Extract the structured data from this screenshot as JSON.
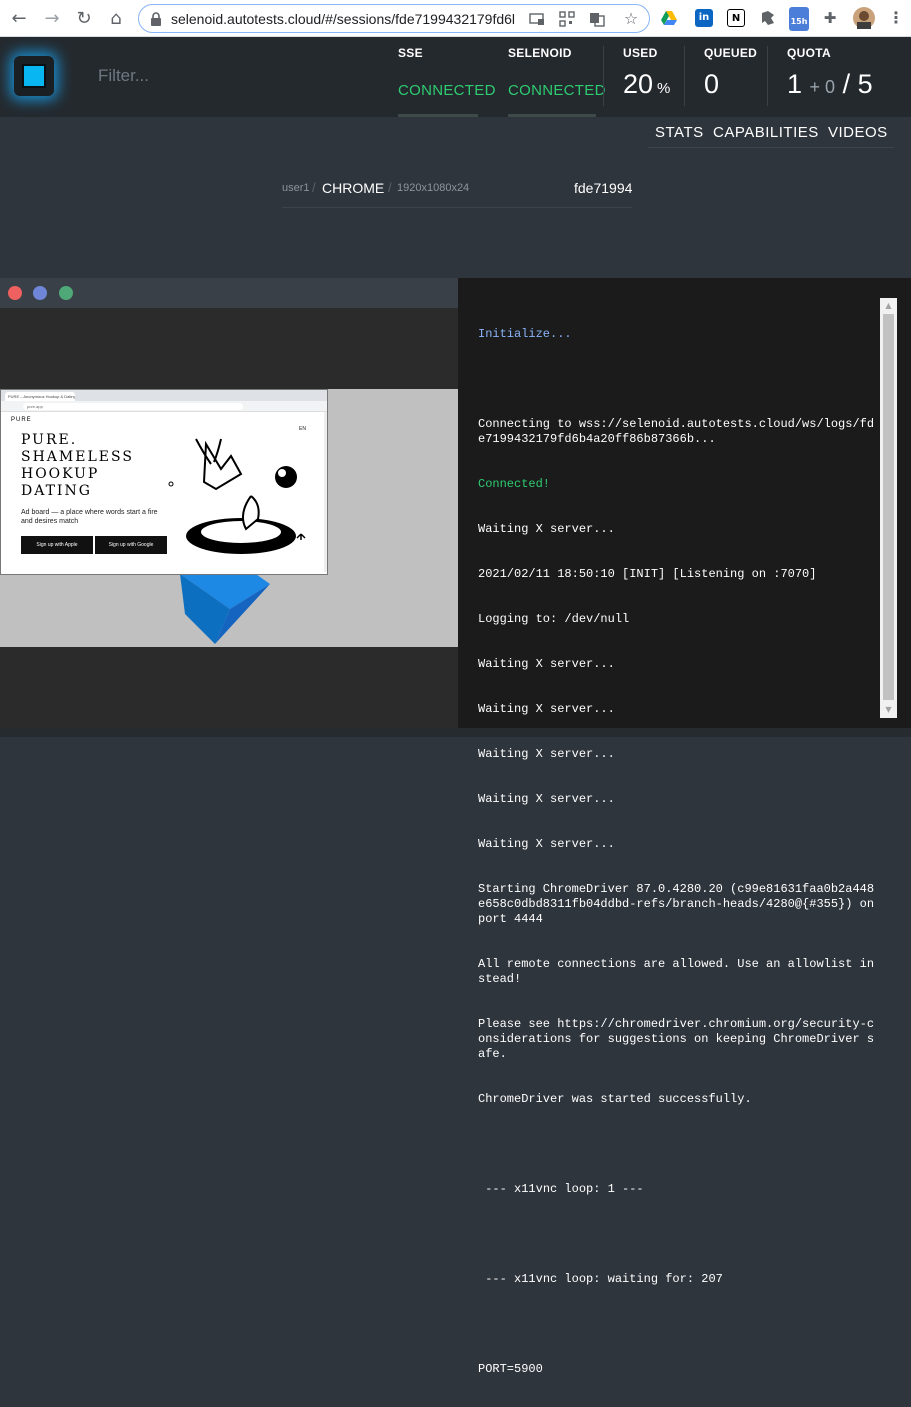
{
  "browser": {
    "url": "selenoid.autotests.cloud/#/sessions/fde7199432179fd6l",
    "back_icon": "←",
    "forward_icon": "→",
    "reload_icon": "↻",
    "home_icon": "⌂",
    "star_icon": "☆",
    "puzzle_icon": "✚",
    "menu_icon": "⋮",
    "ext_badge": "15h"
  },
  "header": {
    "filter_placeholder": "Filter...",
    "sse_label": "SSE",
    "sse_status": "CONNECTED",
    "selenoid_label": "SELENOID",
    "selenoid_status": "CONNECTED",
    "used_label": "USED",
    "used_value": "20",
    "used_unit": "%",
    "queued_label": "QUEUED",
    "queued_value": "0",
    "quota_label": "QUOTA",
    "quota_value": "1",
    "quota_plus": "+ 0",
    "quota_total": "/ 5"
  },
  "subnav": {
    "stats": "STATS",
    "capabilities": "CAPABILITIES",
    "videos": "VIDEOS"
  },
  "session": {
    "user": "user1",
    "sep": "/",
    "browser": "CHROME",
    "resolution": "1920x1080x24",
    "id": "fde71994"
  },
  "vnc": {
    "mini_tab": "PURE – Anonymous Hookup & Dating",
    "mini_url": "pure.app",
    "mini_brand": "PURE",
    "mini_lang": "EN",
    "mini_headline": [
      "PURE.",
      "SHAMELESS",
      "HOOKUP",
      "DATING"
    ],
    "mini_sub": "Ad board — a place where words start a fire and desires match",
    "mini_btn_apple": "Sign up with Apple",
    "mini_btn_google": "Sign up with Google"
  },
  "log": {
    "init": "Initialize...",
    "connecting": "Connecting to wss://selenoid.autotests.cloud/ws/logs/fde7199432179fd6b4a20ff86b87366b...",
    "connected": "Connected!",
    "lines": [
      "Waiting X server...",
      "2021/02/11 18:50:10 [INIT] [Listening on :7070]",
      "Logging to: /dev/null",
      "Waiting X server...",
      "Waiting X server...",
      "Waiting X server...",
      "Waiting X server...",
      "Waiting X server...",
      "Starting ChromeDriver 87.0.4280.20 (c99e81631faa0b2a448e658c0dbd8311fb04ddbd-refs/branch-heads/4280@{#355}) on port 4444",
      "All remote connections are allowed. Use an allowlist instead!",
      "Please see https://chromedriver.chromium.org/security-considerations for suggestions on keeping ChromeDriver safe.",
      "ChromeDriver was started successfully."
    ],
    "loop1": " --- x11vnc loop: 1 ---",
    "loop2": " --- x11vnc loop: waiting for: 207",
    "port": "PORT=5900"
  },
  "colors": {
    "accent_green": "#2ecc71",
    "logo_blue": "#08b6f1",
    "log_blue": "#8ab4f8"
  }
}
